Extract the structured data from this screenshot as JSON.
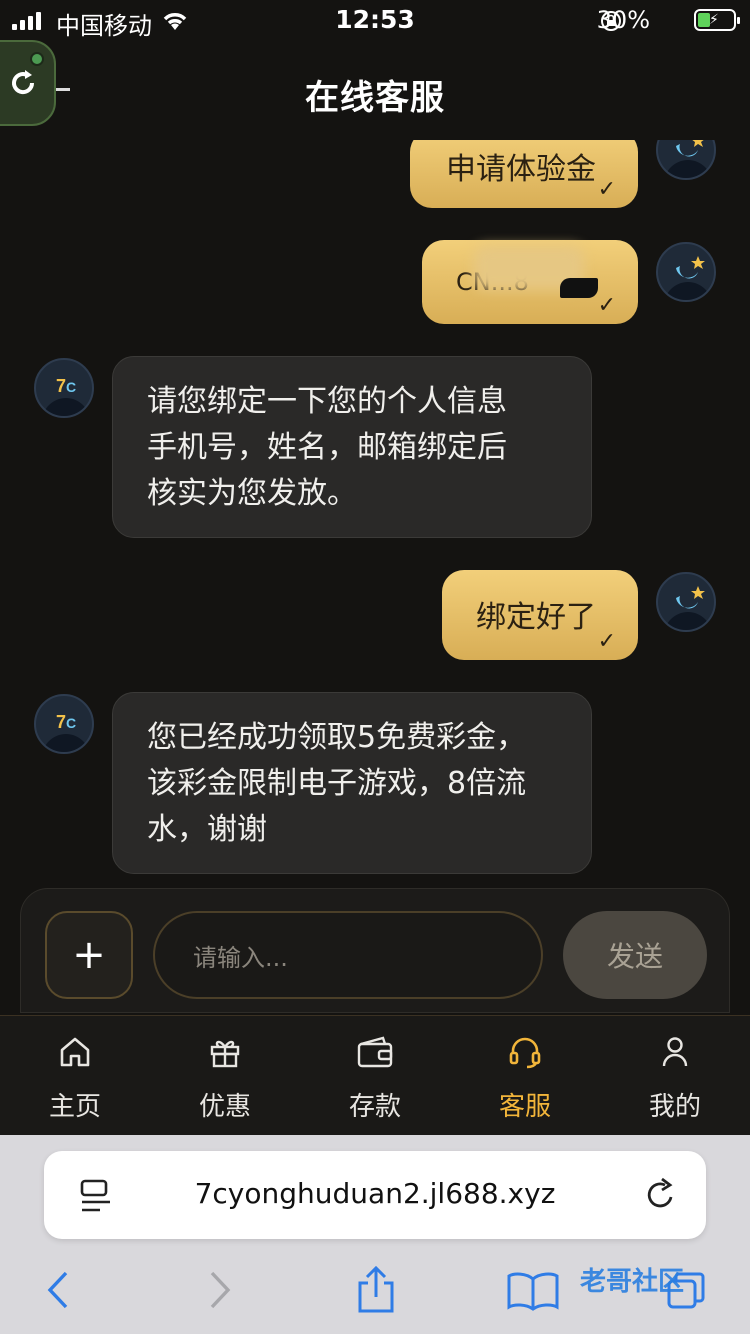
{
  "status": {
    "carrier": "中国移动",
    "time": "12:53",
    "battery": "30%"
  },
  "header": {
    "title": "在线客服"
  },
  "messages": [
    {
      "side": "right",
      "text": "申请体验金"
    },
    {
      "side": "right",
      "text": "CN...8"
    },
    {
      "side": "left",
      "lines": [
        "请您绑定一下您的个人信息",
        "手机号，姓名，邮箱绑定后",
        "核实为您发放。"
      ]
    },
    {
      "side": "right",
      "text": "绑定好了"
    },
    {
      "side": "left",
      "lines": [
        "您已经成功领取5免费彩金，",
        "该彩金限制电子游戏，8倍流",
        "水，谢谢"
      ]
    }
  ],
  "composer": {
    "plus": "+",
    "placeholder": "请输入...",
    "send": "发送"
  },
  "tabs": [
    {
      "label": "主页",
      "icon": "home-icon"
    },
    {
      "label": "优惠",
      "icon": "gift-icon"
    },
    {
      "label": "存款",
      "icon": "wallet-icon"
    },
    {
      "label": "客服",
      "icon": "headset-icon",
      "active": true
    },
    {
      "label": "我的",
      "icon": "user-icon"
    }
  ],
  "browser": {
    "url": "7cyonghuduan2.jl688.xyz",
    "watermark": "老哥社区"
  },
  "colors": {
    "accent": "#f2b53a",
    "bubble_gold": "#e6c06a",
    "background": "#141311"
  }
}
